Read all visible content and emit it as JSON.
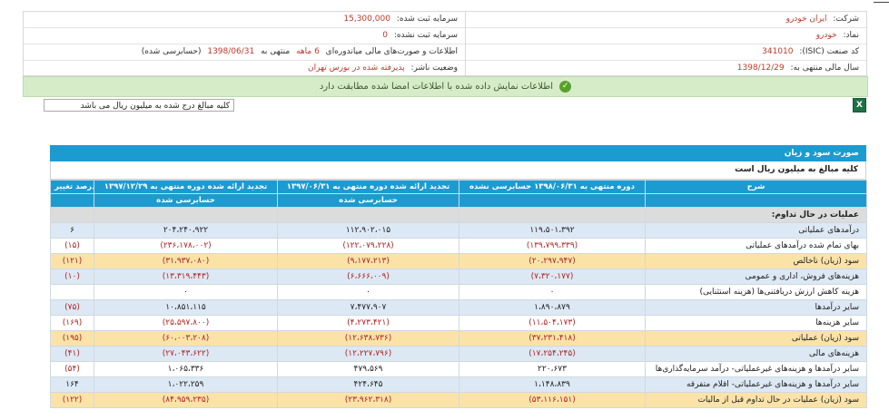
{
  "company_info": {
    "right": [
      {
        "label": "شرکت:",
        "value": "ایران خودرو"
      },
      {
        "label": "نماد:",
        "value": "خودرو"
      },
      {
        "label": "کد صنعت (ISIC):",
        "value": "341010"
      },
      {
        "label": "سال مالی منتهی به:",
        "value": "1398/12/29"
      }
    ],
    "left": [
      {
        "label": "سرمایه ثبت شده:",
        "value": "15,300,000"
      },
      {
        "label": "سرمایه ثبت نشده:",
        "value": "0"
      },
      {
        "label": "اطلاعات و صورت‌های مالی میاندوره‌ای",
        "value": "6 ماهه",
        "mid": "منتهی به",
        "value2": "1398/06/31",
        "suffix": "(حسابرسی شده)"
      },
      {
        "label": "وضعیت ناشر:",
        "value": "پذیرفته شده در بورس تهران"
      }
    ]
  },
  "alert": {
    "text": "اطلاعات نمایش داده شده با اطلاعات امضا شده مطابقت دارد",
    "icon": "check-icon"
  },
  "unit_select": {
    "value": "کلیه مبالغ درج شده به میلیون ریال می باشد"
  },
  "export_icon": "X",
  "statement": {
    "title": "صورت سود و زیان",
    "subtitle": "کلیه مبالغ به میلیون ریال است",
    "headers": {
      "desc": "شرح",
      "c1": "دوره منتهی به ۱۳۹۸/۰۶/۳۱ حسابرسی نشده",
      "c2_top": "تجدید ارائه شده دوره منتهی به ۱۳۹۷/۰۶/۳۱",
      "c2_bottom": "حسابرسی شده",
      "c3_top": "تجدید ارائه شده دوره منتهی به ۱۳۹۷/۱۲/۲۹",
      "c3_bottom": "حسابرسی شده",
      "c4": "درصد تغییر"
    },
    "section_label": "عملیات در حال تداوم:",
    "rows": [
      {
        "desc": "درآمدهای عملیاتی",
        "c1": "۱۱۹،۵۰۱،۳۹۲",
        "c2": "۱۱۲،۹۰۲،۰۱۵",
        "c3": "۲۰۴،۲۴۰،۹۲۲",
        "c4": "۶",
        "color": "blue"
      },
      {
        "desc": "بهای تمام شده درآمدهای عملیاتی",
        "c1": "(۱۳۹،۷۹۹،۳۳۹)",
        "c2": "(۱۲۲،۰۷۹،۲۲۸)",
        "c3": "(۲۳۶،۱۷۸،۰۰۲)",
        "c4": "(۱۵)",
        "color": "white"
      },
      {
        "desc": "سود (زیان) ناخالص",
        "c1": "(۲۰،۲۹۷،۹۴۷)",
        "c2": "(۹،۱۷۷،۲۱۳)",
        "c3": "(۳۱،۹۳۷،۰۸۰)",
        "c4": "(۱۲۱)",
        "color": "yellow"
      },
      {
        "desc": "هزینه‌های فروش، اداری و عمومی",
        "c1": "(۷،۳۲۰،۱۷۷)",
        "c2": "(۶،۶۶۶،۰۰۹)",
        "c3": "(۱۳،۳۱۹،۴۴۳)",
        "c4": "(۱۰)",
        "color": "blue"
      },
      {
        "desc": "هزینه کاهش ارزش دریافتنی‌ها (هزینه استثنایی)",
        "c1": "۰",
        "c2": "۰",
        "c3": "۰",
        "c4": "",
        "color": "white"
      },
      {
        "desc": "سایر درآمدها",
        "c1": "۱،۸۹۰،۸۷۹",
        "c2": "۷،۴۷۷،۹۰۷",
        "c3": "۱۰،۸۵۱،۱۱۵",
        "c4": "(۷۵)",
        "color": "blue"
      },
      {
        "desc": "سایر هزینه‌ها",
        "c1": "(۱۱،۵۰۴،۱۷۳)",
        "c2": "(۴،۲۷۳،۴۲۱)",
        "c3": "(۲۵،۵۹۷،۸۰۰)",
        "c4": "(۱۶۹)",
        "color": "white"
      },
      {
        "desc": "سود (زیان) عملیاتی",
        "c1": "(۳۷،۲۳۱،۴۱۸)",
        "c2": "(۱۲،۶۳۸،۷۳۶)",
        "c3": "(۶۰،۰۰۳،۲۰۸)",
        "c4": "(۱۹۵)",
        "color": "yellow"
      },
      {
        "desc": "هزینه‌های مالی",
        "c1": "(۱۷،۲۵۴،۲۴۵)",
        "c2": "(۱۲،۲۲۷،۷۹۶)",
        "c3": "(۲۷،۰۴۳،۶۲۲)",
        "c4": "(۴۱)",
        "color": "blue"
      },
      {
        "desc": "سایر درآمدها و هزینه‌های غیرعملیاتی- درآمد سرمایه‌گذاری‌ها",
        "c1": "۲۲۰،۶۷۳",
        "c2": "۴۷۹،۵۶۹",
        "c3": "۱،۰۶۵،۳۳۶",
        "c4": "(۵۴)",
        "color": "white"
      },
      {
        "desc": "سایر درآمدها و هزینه‌های غیرعملیاتی- اقلام متفرقه",
        "c1": "۱،۱۴۸،۸۳۹",
        "c2": "۴۲۴،۶۴۵",
        "c3": "۱،۰۲۲،۲۵۹",
        "c4": "۱۶۴",
        "color": "blue"
      },
      {
        "desc": "سود (زیان) عملیات در حال تداوم قبل از مالیات",
        "c1": "(۵۳،۱۱۶،۱۵۱)",
        "c2": "(۲۳،۹۶۲،۳۱۸)",
        "c3": "(۸۴،۹۵۹،۲۳۵)",
        "c4": "(۱۲۲)",
        "color": "yellow"
      }
    ]
  }
}
